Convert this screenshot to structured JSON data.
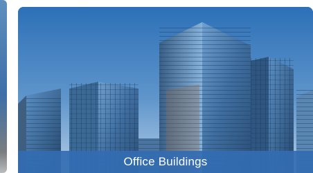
{
  "cards": [
    {
      "caption": "Office Buildings",
      "image": "office-buildings-photo"
    }
  ],
  "colors": {
    "caption_bar": "#336cb2",
    "sky_top": "#2f72b8",
    "sky_bottom": "#a9c7e2"
  }
}
